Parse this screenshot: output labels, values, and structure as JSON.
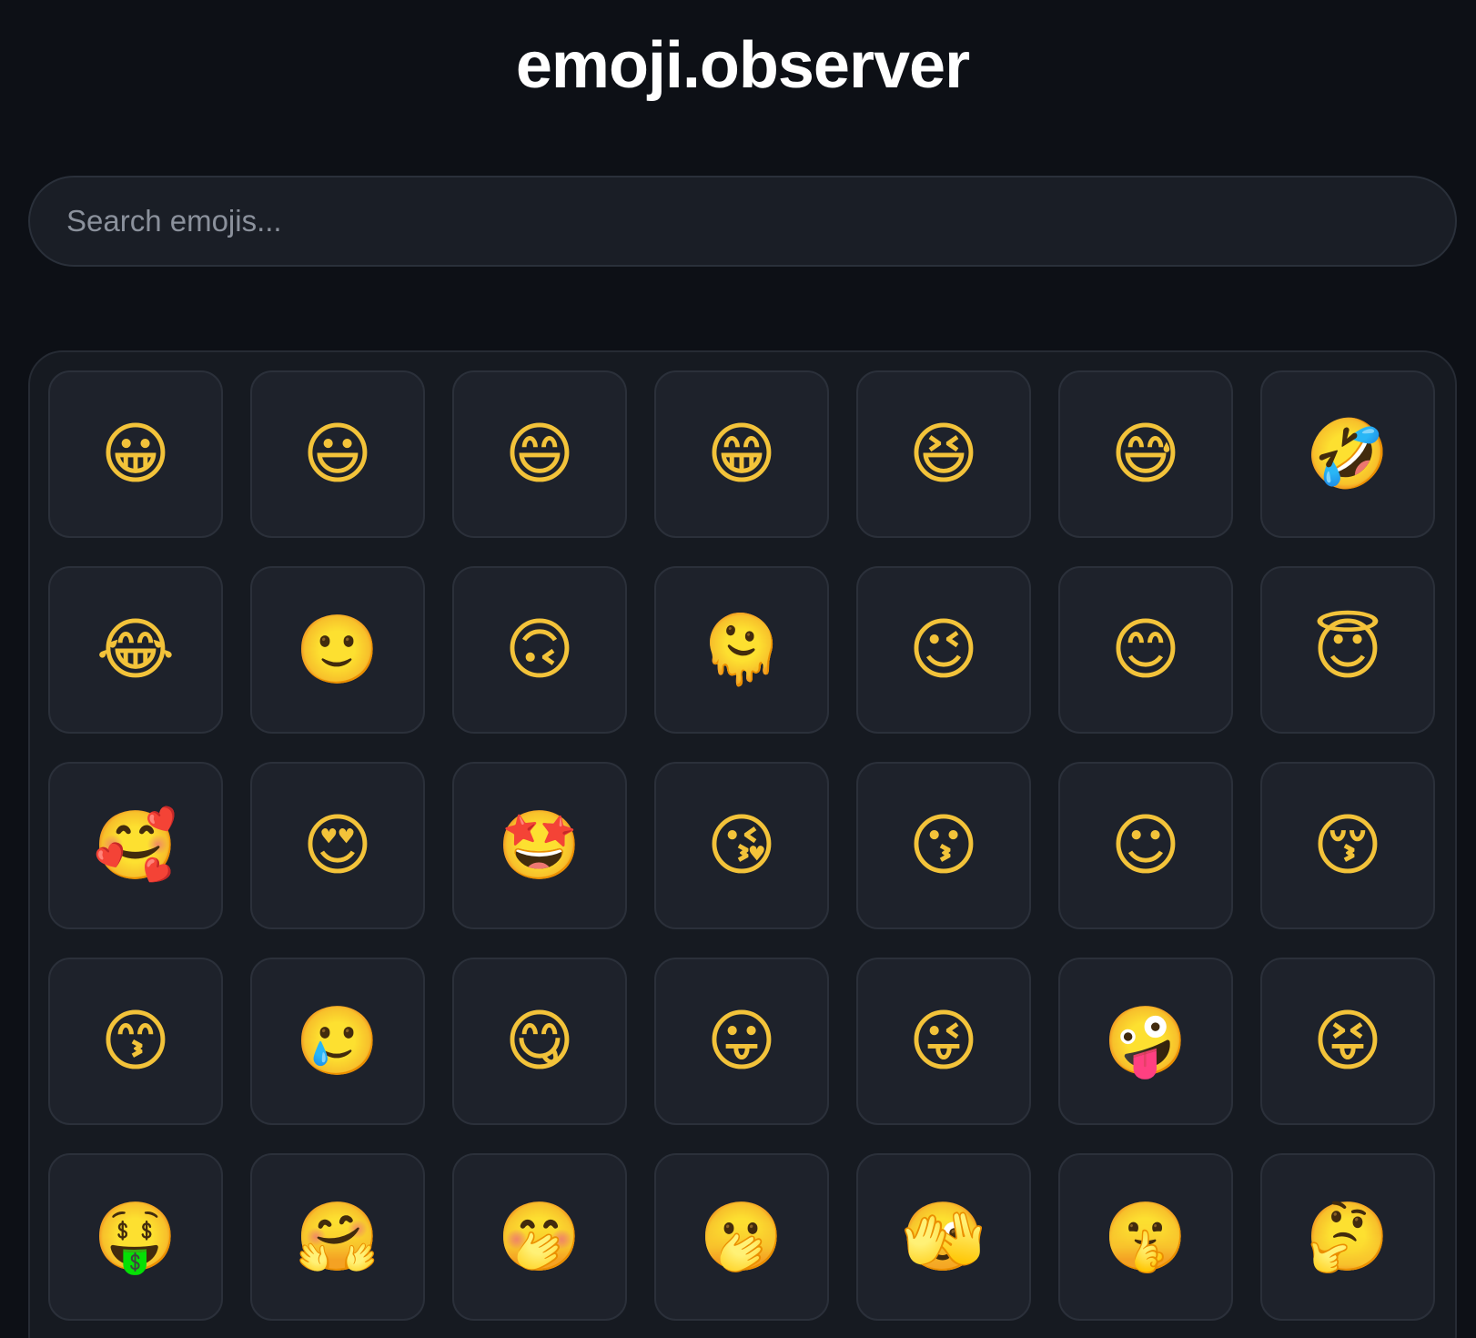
{
  "app": {
    "title": "emoji.observer"
  },
  "search": {
    "placeholder": "Search emojis...",
    "value": ""
  },
  "emojis": [
    {
      "char": "😀",
      "name": "grinning-face"
    },
    {
      "char": "😃",
      "name": "grinning-face-with-big-eyes"
    },
    {
      "char": "😄",
      "name": "grinning-face-with-smiling-eyes"
    },
    {
      "char": "😁",
      "name": "beaming-face-with-smiling-eyes"
    },
    {
      "char": "😆",
      "name": "grinning-squinting-face"
    },
    {
      "char": "😅",
      "name": "grinning-face-with-sweat"
    },
    {
      "char": "🤣",
      "name": "rolling-on-the-floor-laughing"
    },
    {
      "char": "😂",
      "name": "face-with-tears-of-joy"
    },
    {
      "char": "🙂",
      "name": "slightly-smiling-face"
    },
    {
      "char": "🙃",
      "name": "upside-down-face"
    },
    {
      "char": "🫠",
      "name": "melting-face"
    },
    {
      "char": "😉",
      "name": "winking-face"
    },
    {
      "char": "😊",
      "name": "smiling-face-with-smiling-eyes"
    },
    {
      "char": "😇",
      "name": "smiling-face-with-halo"
    },
    {
      "char": "🥰",
      "name": "smiling-face-with-hearts"
    },
    {
      "char": "😍",
      "name": "smiling-face-with-heart-eyes"
    },
    {
      "char": "🤩",
      "name": "star-struck"
    },
    {
      "char": "😘",
      "name": "face-blowing-a-kiss"
    },
    {
      "char": "😗",
      "name": "kissing-face"
    },
    {
      "char": "☺",
      "name": "smiling-face"
    },
    {
      "char": "😚",
      "name": "kissing-face-with-closed-eyes"
    },
    {
      "char": "😙",
      "name": "kissing-face-with-smiling-eyes"
    },
    {
      "char": "🥲",
      "name": "smiling-face-with-tear"
    },
    {
      "char": "😋",
      "name": "face-savoring-food"
    },
    {
      "char": "😛",
      "name": "face-with-tongue"
    },
    {
      "char": "😜",
      "name": "winking-face-with-tongue"
    },
    {
      "char": "🤪",
      "name": "zany-face"
    },
    {
      "char": "😝",
      "name": "squinting-face-with-tongue"
    },
    {
      "char": "🤑",
      "name": "money-mouth-face"
    },
    {
      "char": "🤗",
      "name": "smiling-face-with-open-hands"
    },
    {
      "char": "🤭",
      "name": "face-with-hand-over-mouth"
    },
    {
      "char": "🫢",
      "name": "face-with-open-eyes-and-hand-over-mouth"
    },
    {
      "char": "🫣",
      "name": "face-with-peeking-eye"
    },
    {
      "char": "🤫",
      "name": "shushing-face"
    },
    {
      "char": "🤔",
      "name": "thinking-face"
    }
  ]
}
